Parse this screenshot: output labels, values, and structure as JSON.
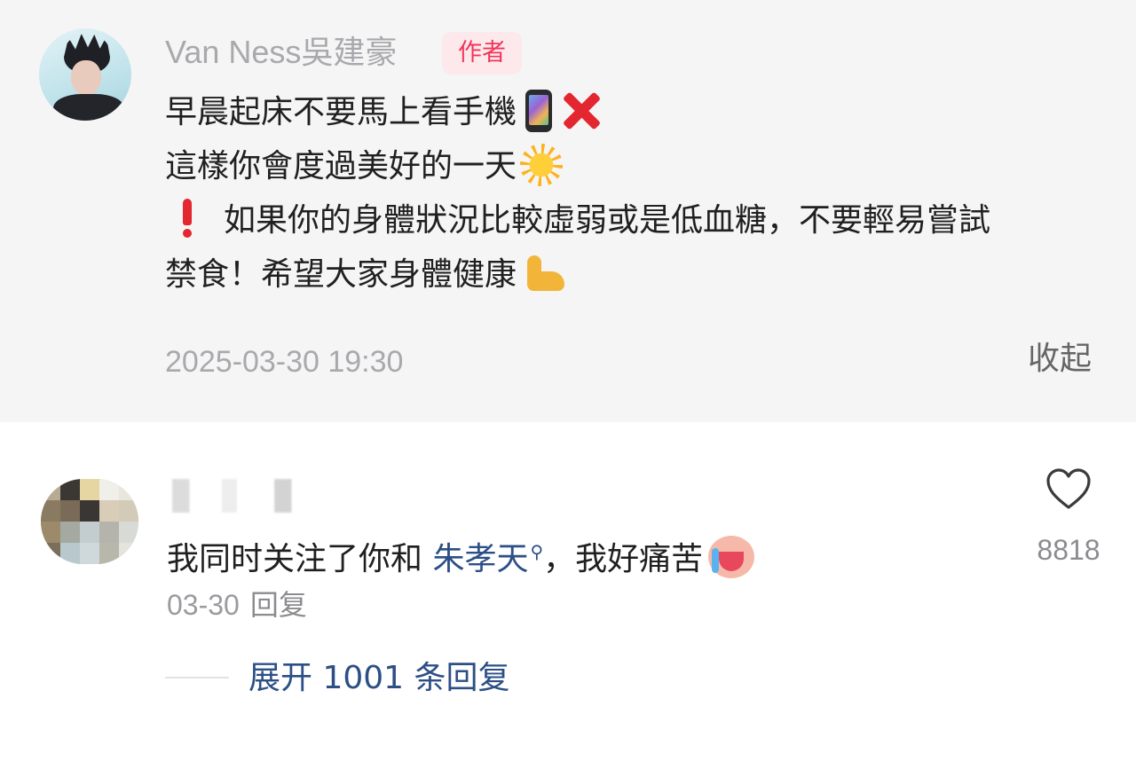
{
  "author_comment": {
    "username": "Van Ness吳建豪",
    "badge": "作者",
    "lines": [
      "早晨起床不要馬上看手機",
      "這樣你會度過美好的一天",
      "如果你的身體狀況比較虛弱或是低血糖，不要輕易嘗試",
      "禁食！希望大家身體健康"
    ],
    "timestamp": "2025-03-30 19:30",
    "collapse_label": "收起"
  },
  "reply_comment": {
    "text_before": "我同时关注了你和 ",
    "mention": "朱孝天",
    "text_after": "，我好痛苦",
    "date": "03-30",
    "reply_label": "回复",
    "like_count": "8818",
    "expand_label": "展开 1001 条回复"
  },
  "colors": {
    "author_background": "#f5f5f5",
    "badge_text": "#f0365a",
    "badge_background": "#fde9ec",
    "link": "#2c4f86"
  },
  "icons": [
    "mobile-phone-icon",
    "cross-mark-icon",
    "sun-icon",
    "exclamation-icon",
    "flexed-biceps-icon",
    "magnifier-icon",
    "crying-face-icon",
    "heart-icon"
  ]
}
